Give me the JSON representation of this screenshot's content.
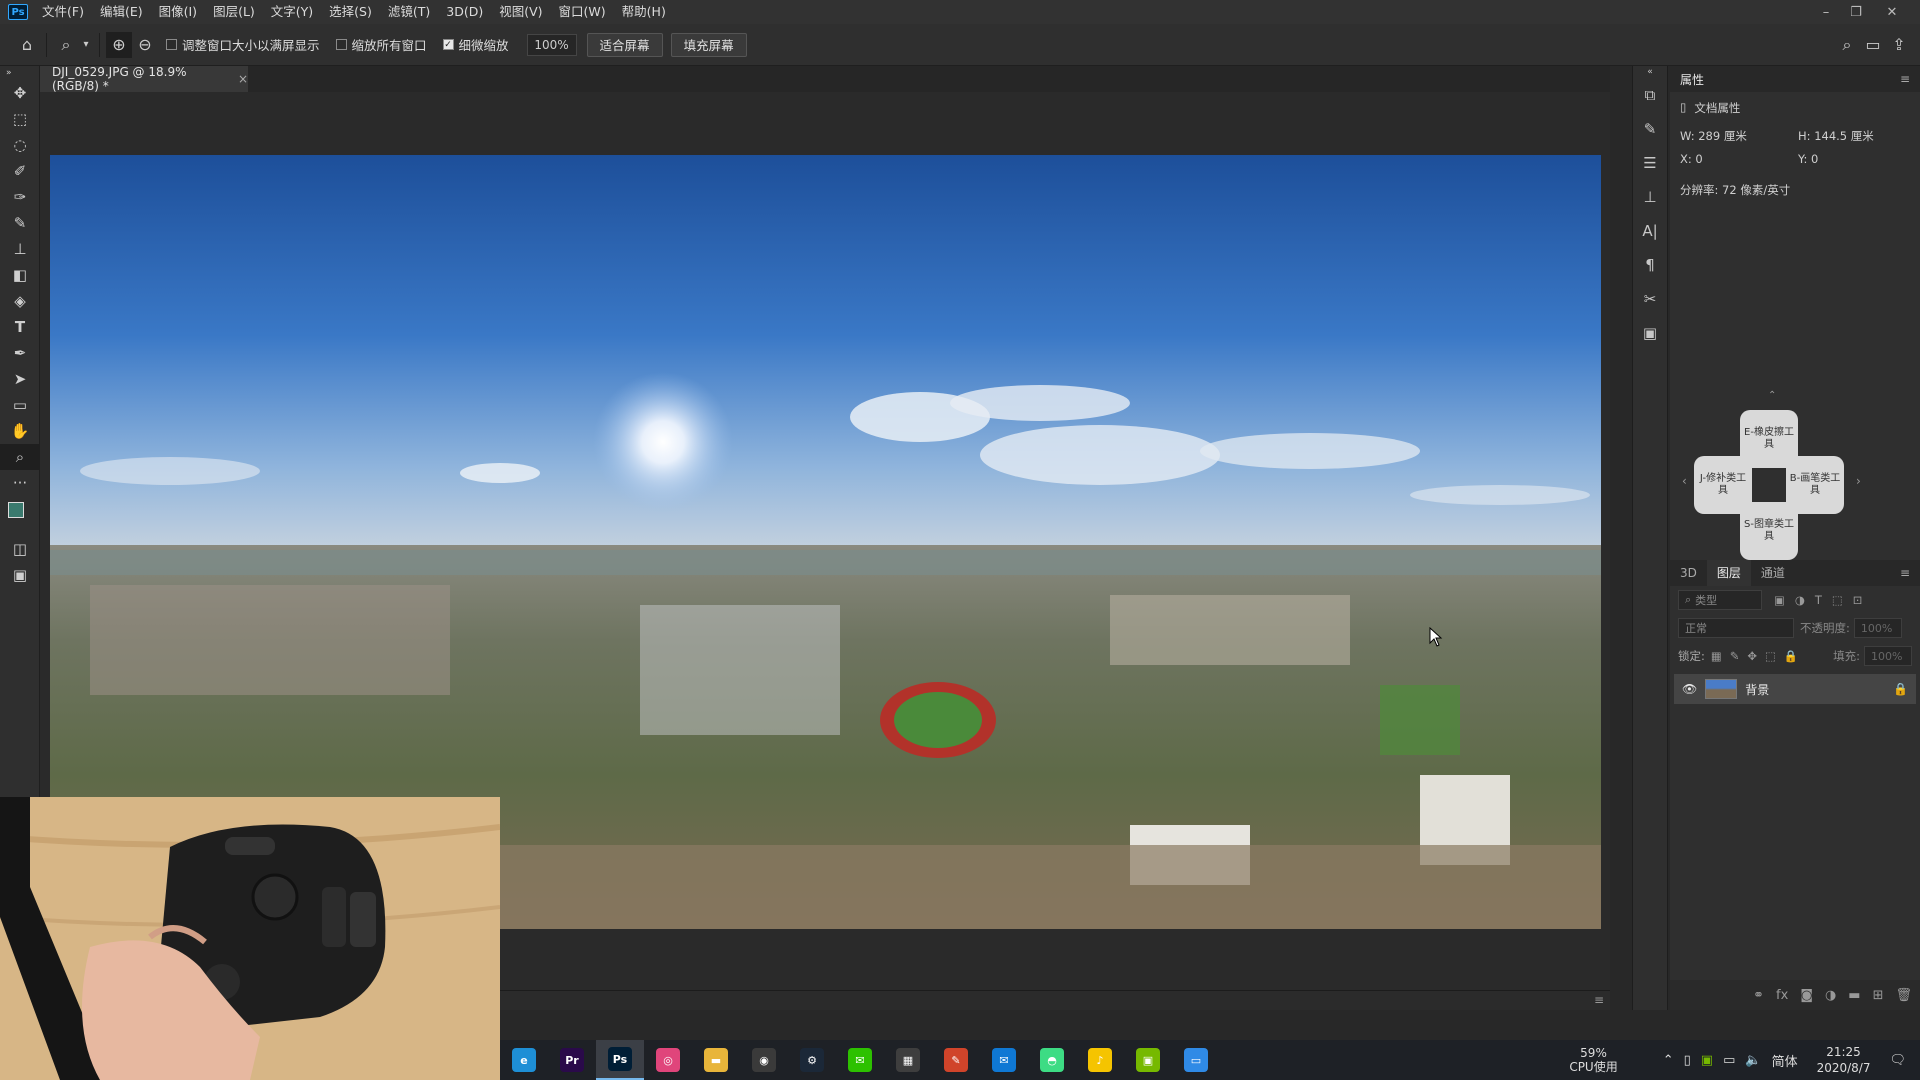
{
  "app": {
    "logo": "Ps"
  },
  "menu": [
    "文件(F)",
    "编辑(E)",
    "图像(I)",
    "图层(L)",
    "文字(Y)",
    "选择(S)",
    "滤镜(T)",
    "3D(D)",
    "视图(V)",
    "窗口(W)",
    "帮助(H)"
  ],
  "window_controls": {
    "minimize": "–",
    "restore": "❐",
    "close": "✕"
  },
  "options": {
    "resize_windows_label": "调整窗口大小以满屏显示",
    "zoom_all_label": "缩放所有窗口",
    "scrubby_zoom_label": "细微缩放",
    "zoom_value": "100%",
    "fit_screen_label": "适合屏幕",
    "fill_screen_label": "填充屏幕"
  },
  "document_tab": {
    "title": "DJI_0529.JPG @ 18.9%(RGB/8) *",
    "close": "×"
  },
  "properties": {
    "panel_title": "属性",
    "section_label": "文档属性",
    "width_label": "W:",
    "width_value": "289 厘米",
    "height_label": "H:",
    "height_value": "144.5 厘米",
    "x_label": "X:",
    "x_value": "0",
    "y_label": "Y:",
    "y_value": "0",
    "resolution": "分辨率: 72 像素/英寸"
  },
  "dial": {
    "top": "E-橡皮擦工具",
    "left": "J-修补类工具",
    "right": "B-画笔类工具",
    "bottom": "S-图章类工具"
  },
  "layers": {
    "tab_3d": "3D",
    "tab_layers": "图层",
    "tab_channels": "通道",
    "filter_placeholder": "类型",
    "blend_mode": "正常",
    "opacity_label": "不透明度:",
    "opacity_value": "100%",
    "lock_label": "锁定:",
    "fill_label": "填充:",
    "fill_value": "100%",
    "layer_name": "背景"
  },
  "taskbar": {
    "apps": [
      {
        "name": "edge",
        "label": "e",
        "color": "#1e8fd6"
      },
      {
        "name": "premiere",
        "label": "Pr",
        "color": "#2a0a4a"
      },
      {
        "name": "photoshop",
        "label": "Ps",
        "color": "#001e36"
      },
      {
        "name": "gallery",
        "label": "◎",
        "color": "#e0457b"
      },
      {
        "name": "explorer",
        "label": "▬",
        "color": "#e8b53a"
      },
      {
        "name": "davinci",
        "label": "◉",
        "color": "#3a3a3a"
      },
      {
        "name": "steam",
        "label": "⚙",
        "color": "#1b2838"
      },
      {
        "name": "wechat",
        "label": "✉",
        "color": "#2dc100"
      },
      {
        "name": "store",
        "label": "▦",
        "color": "#3e3e3e"
      },
      {
        "name": "paint",
        "label": "✎",
        "color": "#d0442a"
      },
      {
        "name": "mail",
        "label": "✉",
        "color": "#0f78d4"
      },
      {
        "name": "android",
        "label": "◓",
        "color": "#3ddc84"
      },
      {
        "name": "music",
        "label": "♪",
        "color": "#f5c400"
      },
      {
        "name": "nvidia",
        "label": "▣",
        "color": "#76b900"
      },
      {
        "name": "remote",
        "label": "▭",
        "color": "#2f8ae6"
      }
    ],
    "cpu_value": "59%",
    "cpu_label": "CPU使用",
    "ime": "简体",
    "time": "21:25",
    "date": "2020/8/7"
  },
  "colors": {
    "accent": "#31a8ff",
    "menubar": "#323232",
    "panel": "#2f2f2f",
    "canvas_bg": "#2a2a2a"
  }
}
